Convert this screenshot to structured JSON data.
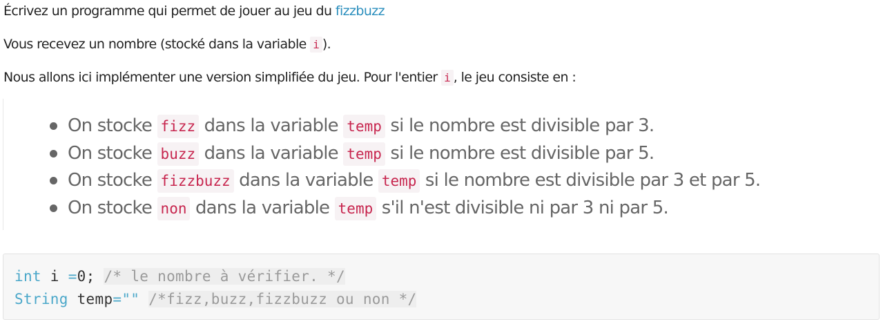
{
  "intro": {
    "line1_text": "Écrivez un programme qui permet de jouer au jeu du ",
    "line1_link": "fizzbuzz",
    "line2_before": "Vous recevez un nombre (stocké dans la variable ",
    "line2_code": "i",
    "line2_after": ").",
    "line3_before": "Nous allons ici implémenter une version simplifiée du jeu. Pour l'entier ",
    "line3_code": "i",
    "line3_after": ", le jeu consiste en :"
  },
  "rules": [
    {
      "prefix": "On stocke ",
      "value": "fizz",
      "middle": " dans la variable ",
      "var": "temp",
      "suffix": " si le nombre est divisible par 3."
    },
    {
      "prefix": "On stocke ",
      "value": "buzz",
      "middle": " dans la variable ",
      "var": "temp",
      "suffix": " si le nombre est divisible par 5."
    },
    {
      "prefix": "On stocke ",
      "value": "fizzbuzz",
      "middle": " dans la variable ",
      "var": "temp",
      "suffix": " si le nombre est divisible par 3 et par 5."
    },
    {
      "prefix": "On stocke ",
      "value": "non",
      "middle": " dans la variable ",
      "var": "temp",
      "suffix": " s'il n'est divisible ni par 3 ni par 5."
    }
  ],
  "code": {
    "line1": {
      "type": "int",
      "name": " i ",
      "op": "=",
      "value": "0;",
      "comment": "/* le nombre à vérifier. */"
    },
    "line2": {
      "type": "String",
      "name": " temp",
      "op": "=",
      "value": "\"\"",
      "comment": "/*fizz,buzz,fizzbuzz ou non */"
    }
  }
}
